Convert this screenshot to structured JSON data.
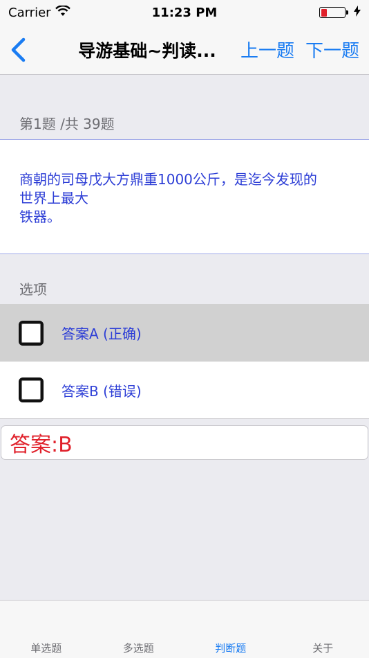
{
  "status_bar": {
    "carrier": "Carrier",
    "time": "11:23 PM",
    "battery_level": 0.25,
    "battery_color": "#e0202a"
  },
  "nav": {
    "title": "导游基础~判读...",
    "prev_label": "上一题",
    "next_label": "下一题",
    "accent_color": "#1a7cf2"
  },
  "question": {
    "progress": "第1题 /共 39题",
    "text": "商朝的司母戊大方鼎重1000公斤，是迄今发现的\n世界上最大\n铁器。",
    "text_color": "#2d3ed6"
  },
  "options": {
    "header": "选项",
    "items": [
      {
        "label": "答案A (正确)",
        "selected": true
      },
      {
        "label": "答案B (错误)",
        "selected": false
      }
    ]
  },
  "answer": {
    "text": "答案:B",
    "color": "#e0202a"
  },
  "tabs": [
    {
      "label": "单选题",
      "active": false
    },
    {
      "label": "多选题",
      "active": false
    },
    {
      "label": "判断题",
      "active": true
    },
    {
      "label": "关于",
      "active": false
    }
  ]
}
